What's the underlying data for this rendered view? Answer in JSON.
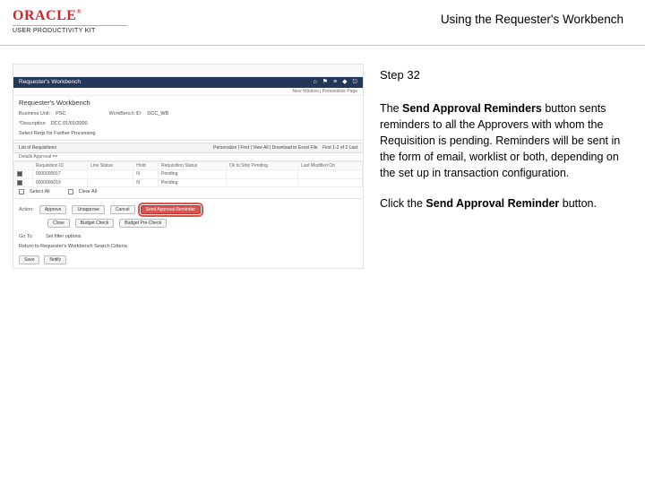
{
  "header": {
    "logo_text": "ORACLE",
    "logo_reg": "®",
    "upk": "USER PRODUCTIVITY KIT",
    "title": "Using the Requester's Workbench"
  },
  "instructions": {
    "step_label": "Step 32",
    "p1_a": "The ",
    "p1_b": "Send Approval Reminders",
    "p1_c": " button sents reminders to all the Approvers with whom the Requisition is pending. Reminders will be sent in the form of email, worklist or both, depending on the set up in transaction configuration.",
    "p2_a": "Click the ",
    "p2_b": "Send Approval Reminder",
    "p2_c": " button."
  },
  "ss": {
    "banner": "Requester's Workbench",
    "sub": "New Window | Personalize Page",
    "h1": "Requester's Workbench",
    "bu_label": "Business Unit:",
    "bu_value": "PSC",
    "wb_label": "WorkBench ID:",
    "wb_value": "DCC_WB",
    "req_label": "*Description",
    "req_value": "DCC 01/01/2000",
    "select_reqs_label": "Select Reqs for Further Processing",
    "list_header": "List of Requisitions",
    "list_meta_a": "Personalize | Find | View All |",
    "list_meta_b": "Download to Excel File",
    "list_meta_c": "First   1-2 of 2   Last",
    "tabs": "Details    Approval    ==",
    "columns": [
      "",
      "Requisition ID",
      "Line Status",
      "Hold",
      "Requisition Status",
      "Ok to Ship Pending",
      "Last Modified On"
    ],
    "rows": [
      {
        "sel": true,
        "c1": "0000000017",
        "c2": "",
        "c3": "N",
        "c4": "Pending",
        "c5": "",
        "c6": ""
      },
      {
        "sel": true,
        "c1": "0000000019",
        "c2": "",
        "c3": "N",
        "c4": "Pending",
        "c5": "",
        "c6": ""
      }
    ],
    "select_all": "Select All",
    "clear_all": "Clear All",
    "action_label": "Action:",
    "buttons": [
      "Approve",
      "Unapprove",
      "Cancel"
    ],
    "hl_button": "Send Approval Reminder",
    "buttons2": [
      "Close",
      "Budget Check",
      "Budget Pre-Check"
    ],
    "goto_label": "Go To:",
    "goto_value": "Set filter options",
    "return_link": "Return to Requester's Workbench Search Criteria",
    "save_btn": "Save",
    "notify_btn": "Notify",
    "icons": {
      "home": "⌂",
      "flag": "⚑",
      "menu": "≡",
      "badge": "◆",
      "logout": "⎋"
    }
  }
}
